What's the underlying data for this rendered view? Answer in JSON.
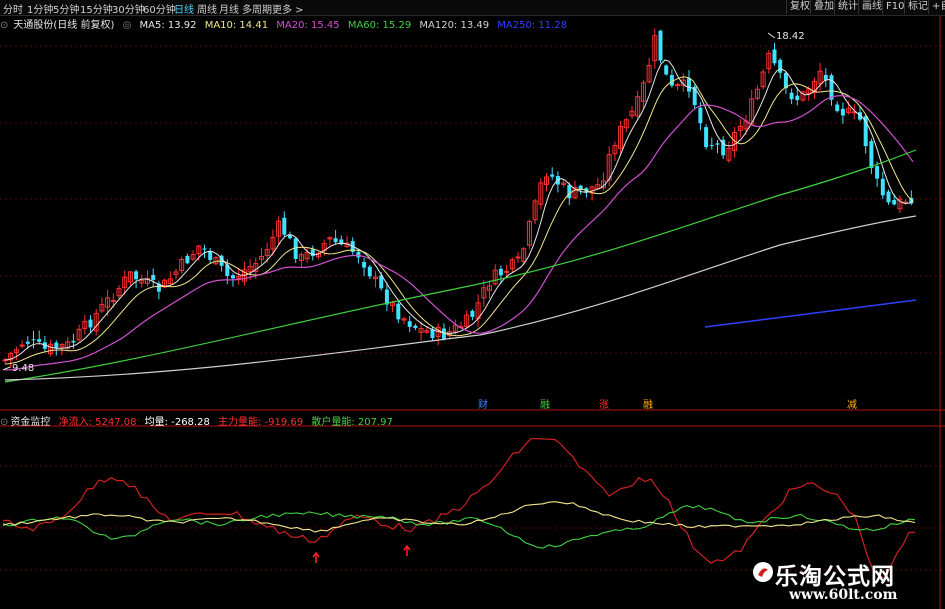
{
  "toolbar": {
    "periods": [
      {
        "label": "分时",
        "active": false
      },
      {
        "label": "1分钟",
        "active": false
      },
      {
        "label": "5分钟",
        "active": false
      },
      {
        "label": "15分钟",
        "active": false
      },
      {
        "label": "30分钟",
        "active": false
      },
      {
        "label": "60分钟",
        "active": false
      },
      {
        "label": "日线",
        "active": true
      },
      {
        "label": "周线",
        "active": false
      },
      {
        "label": "月线",
        "active": false
      },
      {
        "label": "多周期",
        "active": false
      },
      {
        "label": "更多 >",
        "active": false
      }
    ],
    "right_buttons": [
      "复权",
      "叠加",
      "统计",
      "画线",
      "F10",
      "标记",
      "+自"
    ]
  },
  "main_panel": {
    "stock_title": "天通股份(日线 前复权)",
    "ma_legend": [
      {
        "label": "MA5: 13.92",
        "color": "#e8e8e8"
      },
      {
        "label": "MA10: 14.41",
        "color": "#f0e68c"
      },
      {
        "label": "MA20: 15.45",
        "color": "#d050d0"
      },
      {
        "label": "MA60: 15.29",
        "color": "#40d040"
      },
      {
        "label": "MA120: 13.49",
        "color": "#d0d0d0"
      },
      {
        "label": "MA250: 11.28",
        "color": "#3040ff"
      }
    ],
    "high_label": "18.42",
    "low_label": "9.48",
    "event_marks": [
      {
        "text": "财",
        "color": "#4080ff"
      },
      {
        "text": "融",
        "color": "#40d040"
      },
      {
        "text": "涨",
        "color": "#ff3030"
      },
      {
        "text": "融",
        "color": "#ffb000"
      },
      {
        "text": "减",
        "color": "#ffb000"
      }
    ]
  },
  "sub_panel": {
    "indicator_name": "资金监控",
    "legend": [
      {
        "label": "净流入: 5247.08",
        "color": "#ff3030"
      },
      {
        "label": "均量: -268.28",
        "color": "#ffffff"
      },
      {
        "label": "主力量能: -919.69",
        "color": "#ff3030"
      },
      {
        "label": "散户量能: 207.97",
        "color": "#40d040"
      }
    ]
  },
  "watermark": {
    "title": "乐淘公式网",
    "url": "www.60lt.com"
  },
  "colors": {
    "up": "#ff3030",
    "down": "#40e0ff",
    "ma5": "#e8e8e8",
    "ma10": "#f0e68c",
    "ma20": "#d050d0",
    "ma60": "#40d040",
    "ma120": "#d0d0d0",
    "ma250": "#3040ff"
  }
}
